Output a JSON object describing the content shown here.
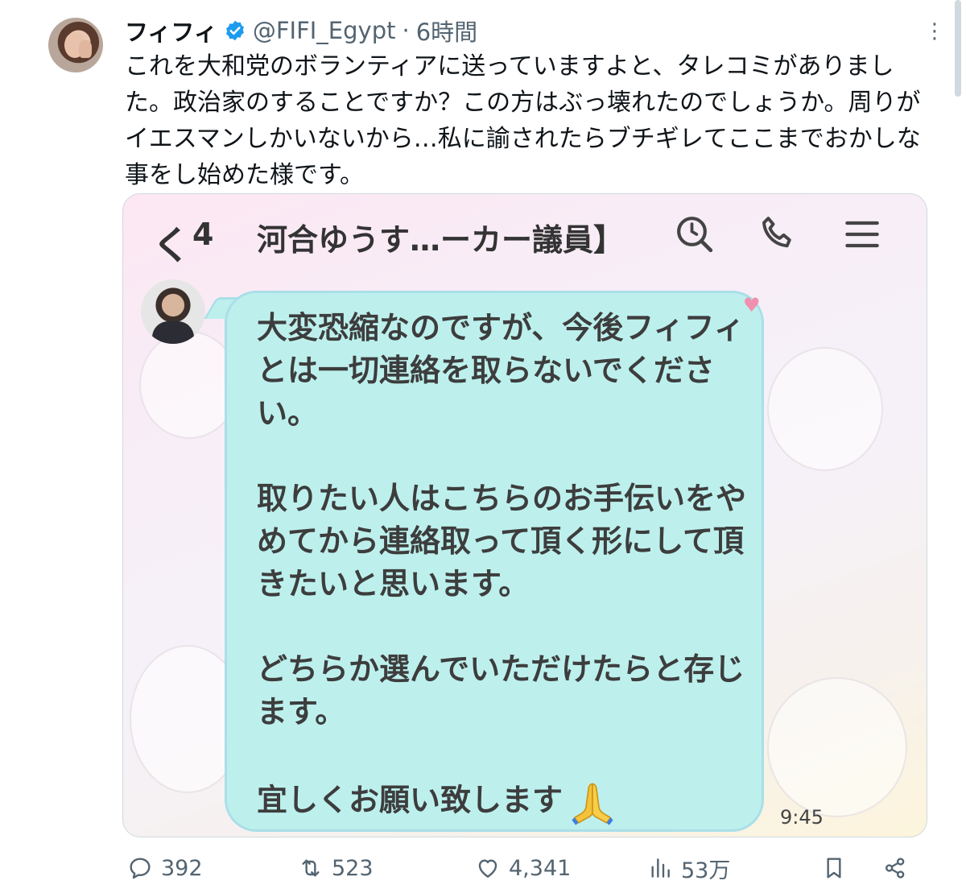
{
  "tweet": {
    "display_name": "フィフィ",
    "handle": "@FIFI_Egypt",
    "separator": "·",
    "time": "6時間",
    "more_label": "⋮",
    "text": "これを大和党のボランティアに送っていますよと、タレコミがありました。政治家のすることですか？この方はぶっ壊れたのでしょうか。周りがイエスマンしかいないから…私に諭されたらブチギレてここまでおかしな事をし始めた様です。"
  },
  "media": {
    "chat_header": {
      "back_glyph": "く",
      "unread_count": "4",
      "title": "河合ゆうす…ーカー議員】"
    },
    "message": {
      "text": "大変恐縮なのですが、今後フィフィとは一切連絡を取らないでください。\n\n取りたい人はこちらのお手伝いをやめてから連絡取って頂く形にして頂きたいと思います。\n\nどちらか選んでいただけたらと存じます。\n\n宜しくお願い致します",
      "time": "9:45"
    },
    "colors": {
      "bubble": "#bdf0ed",
      "bubble_border": "#a9dfe8"
    }
  },
  "actions": {
    "reply_count": "392",
    "retweet_count": "523",
    "like_count": "4,341",
    "view_count": "53万"
  },
  "colors": {
    "text": "#0f1419",
    "secondary": "#536471",
    "verified": "#1d9bf0"
  }
}
